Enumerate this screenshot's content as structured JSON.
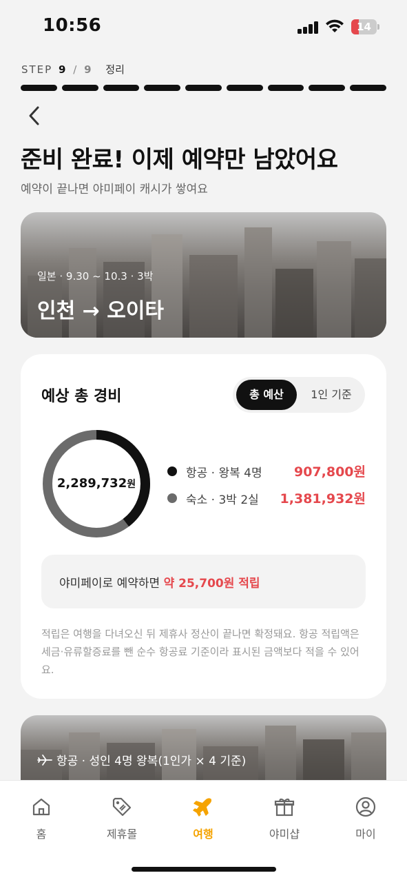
{
  "status_bar": {
    "time": "10:56",
    "battery_level": "14",
    "icons": [
      "signal-icon",
      "wifi-icon",
      "battery-icon"
    ]
  },
  "step": {
    "label": "STEP",
    "current": "9",
    "separator": "/",
    "total": "9",
    "name": "정리",
    "segments_completed": 9,
    "segments_total": 9
  },
  "header": {
    "back_icon": "chevron-left-icon",
    "title": "준비 완료! 이제 예약만 남았어요",
    "subtitle": "예약이 끝나면 야미페이 캐시가 쌓여요"
  },
  "trip": {
    "meta": "일본 · 9.30 ~ 10.3 · 3박",
    "route": "인천 → 오이타"
  },
  "cost": {
    "title": "예상 총 경비",
    "toggle": {
      "options": [
        "총 예산",
        "1인 기준"
      ],
      "selected": "총 예산"
    },
    "total_amount": "2,289,732",
    "total_unit": "원",
    "items": [
      {
        "label": "항공 · 왕복 4명",
        "amount": "907,800원",
        "value": 907800,
        "color": "#111111"
      },
      {
        "label": "숙소 · 3박 2실",
        "amount": "1,381,932원",
        "value": 1381932,
        "color": "#6b6b6b"
      }
    ],
    "reward_prefix": "야미페이로 예약하면",
    "reward_highlight": "약 25,700원 적립",
    "notice": "적립은 여행을 다녀오신 뒤 제휴사 정산이 끝나면 확정돼요. 항공 적립액은 세금·유류할증료를 뺀 순수 항공료 기준이라 표시된 금액보다 적을 수 있어요."
  },
  "flight_card": {
    "icon": "airplane-icon",
    "label": "항공 · 성인 4명 왕복(1인가 × 4 기준)"
  },
  "bottom_nav": {
    "items": [
      {
        "label": "홈",
        "icon": "home-icon",
        "active": false
      },
      {
        "label": "제휴몰",
        "icon": "tag-icon",
        "active": false
      },
      {
        "label": "여행",
        "icon": "airplane-icon",
        "active": true
      },
      {
        "label": "야미샵",
        "icon": "gift-icon",
        "active": false
      },
      {
        "label": "마이",
        "icon": "user-icon",
        "active": false
      }
    ]
  },
  "colors": {
    "accent": "#f5a300",
    "highlight": "#e5484d",
    "dark": "#111111"
  }
}
